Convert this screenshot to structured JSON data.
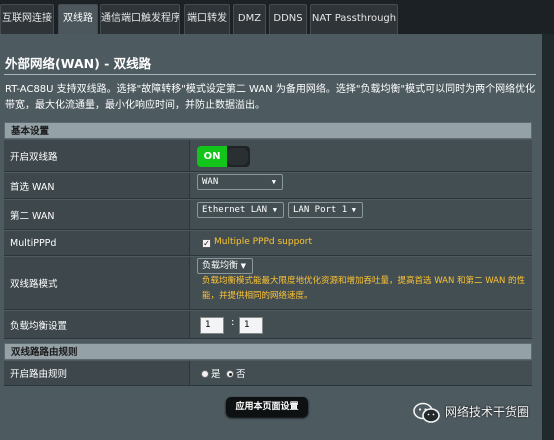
{
  "tabs": [
    {
      "label": "互联网连接"
    },
    {
      "label": "双线路"
    },
    {
      "label": "通信端口触发程序"
    },
    {
      "label": "端口转发"
    },
    {
      "label": "DMZ"
    },
    {
      "label": "DDNS"
    },
    {
      "label": "NAT Passthrough"
    }
  ],
  "page": {
    "title": "外部网络(WAN) - 双线路",
    "description": "RT-AC88U 支持双线路。选择\"故障转移\"模式设定第二 WAN 为备用网络。选择\"负载均衡\"模式可以同时为两个网络优化带宽，最大化流通量，最小化响应时间，并防止数据溢出。"
  },
  "basic": {
    "header": "基本设置",
    "dual_wan": {
      "label": "开启双线路",
      "toggle_text": "ON"
    },
    "primary_wan": {
      "label": "首选 WAN",
      "value": "WAN"
    },
    "secondary_wan": {
      "label": "第二 WAN",
      "value": "Ethernet LAN",
      "port": "LAN Port 1"
    },
    "multippp": {
      "label": "MultiPPPd",
      "checkbox_label": "Multiple PPPd support"
    },
    "mode": {
      "label": "双线路模式",
      "value": "负载均衡",
      "hint": "负载均衡模式能最大限度地优化资源和增加吞吐量，提高首选 WAN 和第二 WAN 的性能，并提供相同的网络速度。"
    },
    "ratio": {
      "label": "负载均衡设置",
      "left": "1",
      "sep": ":",
      "right": "1"
    }
  },
  "routing": {
    "header": "双线路路由规则",
    "enable": {
      "label": "开启路由规则",
      "yes": "是",
      "no": "否"
    }
  },
  "apply_label": "应用本页面设置",
  "watermark": "网络技术干货圈",
  "colors": {
    "accent_green": "#13c51b",
    "hint_yellow": "#fcc333",
    "panel": "#4d5a60"
  }
}
